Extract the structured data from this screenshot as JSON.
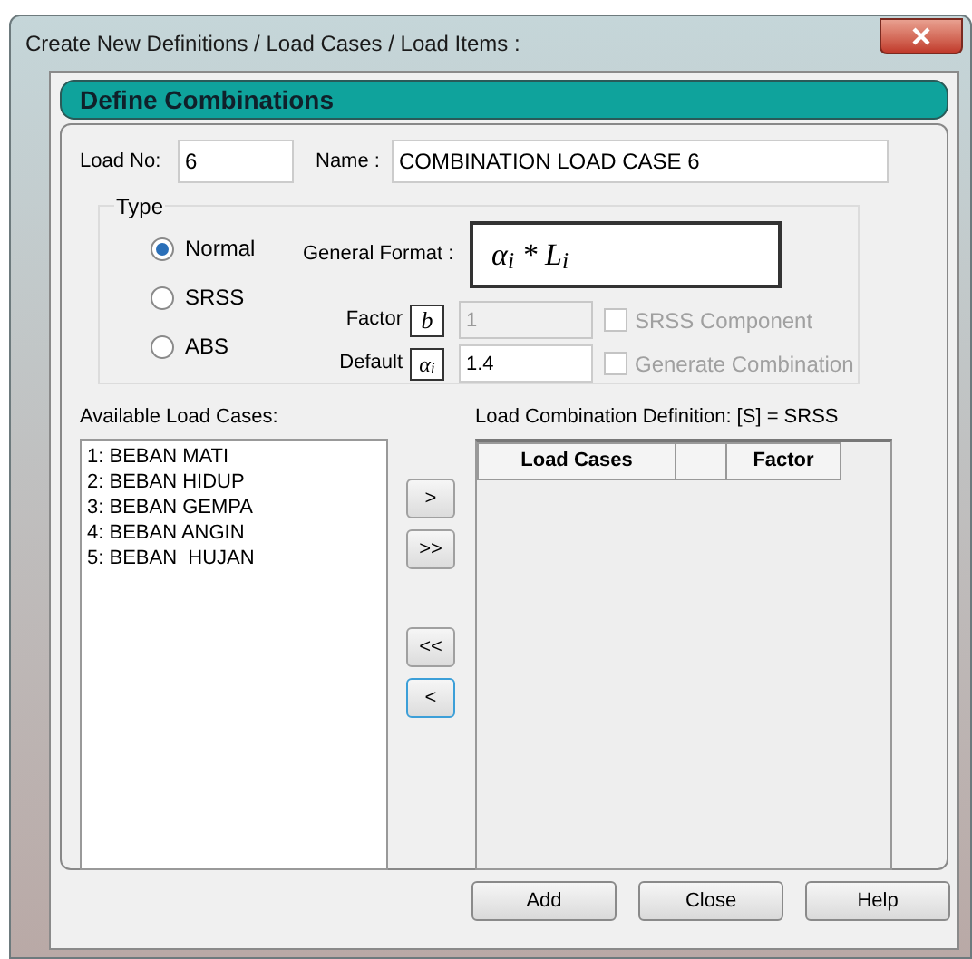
{
  "window": {
    "title": "Create New Definitions / Load Cases / Load Items :"
  },
  "header": "Define Combinations",
  "load_no": {
    "label": "Load No:",
    "value": "6"
  },
  "name": {
    "label": "Name :",
    "value": "COMBINATION LOAD CASE 6"
  },
  "type": {
    "label": "Type",
    "options": [
      {
        "label": "Normal",
        "selected": true
      },
      {
        "label": "SRSS",
        "selected": false
      },
      {
        "label": "ABS",
        "selected": false
      }
    ]
  },
  "general_format": {
    "label": "General Format :",
    "formula": "α$_{i}$ * L$_{i}$"
  },
  "factor": {
    "label": "Factor",
    "symbol": "b",
    "value": "1",
    "disabled": true
  },
  "srss_component": {
    "label": "SRSS Component",
    "checked": false,
    "disabled": true
  },
  "default": {
    "label": "Default",
    "symbol": "α$_{i}$",
    "value": "1.4"
  },
  "generate_combination": {
    "label": "Generate Combination",
    "checked": false,
    "disabled": true
  },
  "available": {
    "label": "Available Load Cases:",
    "items": [
      "1: BEBAN MATI",
      "2: BEBAN HIDUP",
      "3: BEBAN GEMPA",
      "4: BEBAN ANGIN",
      "5: BEBAN  HUJAN"
    ]
  },
  "move_buttons": [
    {
      "label": ">",
      "focused": false
    },
    {
      "label": ">>",
      "focused": false
    },
    {
      "label": "<<",
      "focused": false
    },
    {
      "label": "<",
      "focused": true
    }
  ],
  "combination": {
    "label": "Load Combination Definition:  [S] = SRSS",
    "columns": [
      "Load Cases",
      "Factor"
    ]
  },
  "buttons": [
    "Add",
    "Close",
    "Help"
  ]
}
